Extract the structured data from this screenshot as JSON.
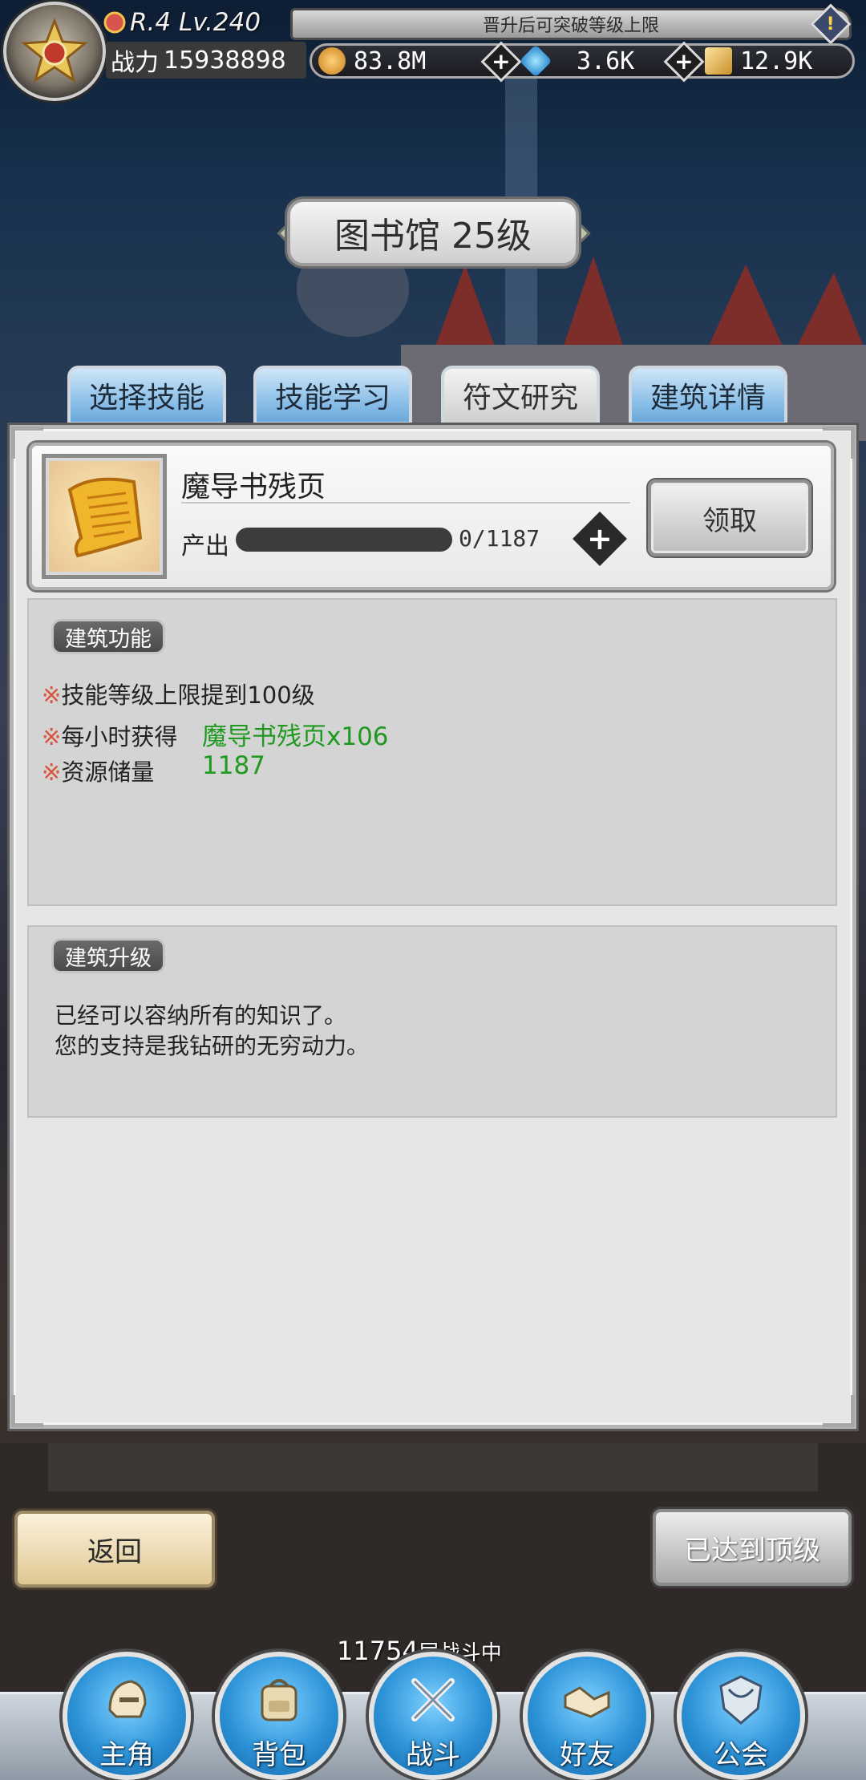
{
  "header": {
    "rank_level": "R.4 Lv.240",
    "notice": "晋升后可突破等级上限",
    "power_label": "战力",
    "power_value": "15938898",
    "resources": [
      {
        "icon": "gold-coin-icon",
        "value": "83.8M"
      },
      {
        "icon": "blue-gem-icon",
        "value": "3.6K"
      },
      {
        "icon": "ticket-icon",
        "value": "12.9K"
      }
    ]
  },
  "building_title": "图书馆 25级",
  "tabs": [
    {
      "label": "选择技能",
      "active": false
    },
    {
      "label": "技能学习",
      "active": false
    },
    {
      "label": "符文研究",
      "active": true
    },
    {
      "label": "建筑详情",
      "active": false
    }
  ],
  "item": {
    "name": "魔导书残页",
    "output_label": "产出",
    "progress_text": "0/1187",
    "progress": 0,
    "claim_label": "领取"
  },
  "function_section": {
    "tag": "建筑功能",
    "lines": [
      {
        "mark": "※",
        "label": "技能等级上限提到100级",
        "value": ""
      },
      {
        "mark": "※",
        "label": "每小时获得",
        "value": "魔导书残页x106"
      },
      {
        "mark": "※",
        "label": "资源储量",
        "value": "1187"
      }
    ]
  },
  "upgrade_section": {
    "tag": "建筑升级",
    "line1": "已经可以容纳所有的知识了。",
    "line2": "您的支持是我钻研的无穷动力。"
  },
  "buttons": {
    "back": "返回",
    "maxed": "已达到顶级"
  },
  "battle_status": {
    "floor": "11754",
    "text": "层战斗中"
  },
  "nav": [
    {
      "label": "主角",
      "icon": "helmet-icon"
    },
    {
      "label": "背包",
      "icon": "backpack-icon"
    },
    {
      "label": "战斗",
      "icon": "crossed-swords-icon"
    },
    {
      "label": "好友",
      "icon": "handshake-icon"
    },
    {
      "label": "公会",
      "icon": "guild-emblem-icon"
    }
  ],
  "colors": {
    "tab_blue": "#8fc1e8",
    "value_green": "#1f9a1f",
    "mark_red": "#d8553b",
    "nav_blue": "#2d93d8"
  }
}
